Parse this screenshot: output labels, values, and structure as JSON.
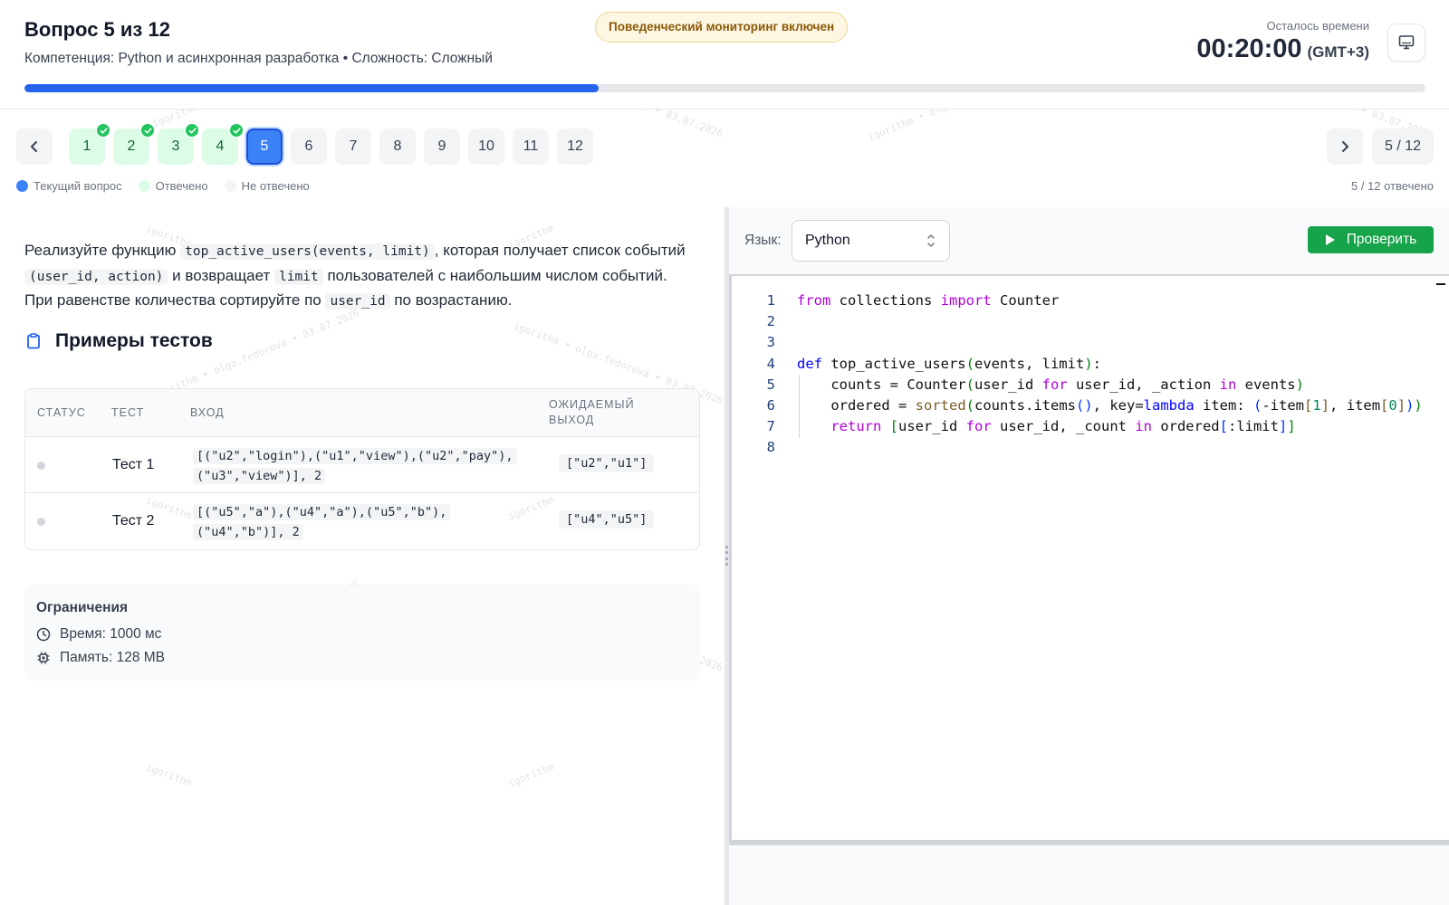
{
  "header": {
    "title": "Вопрос 5 из 12",
    "subtitle": "Компетенция: Python и асинхронная разработка • Сложность: Сложный",
    "monitoring_badge": "Поведенческий мониторинг включен",
    "time_label": "Осталось времени",
    "time_value": "00:20:00",
    "timezone": "(GMT+3)",
    "progress_fraction": 0.41
  },
  "nav": {
    "questions": [
      {
        "label": "1",
        "state": "answered"
      },
      {
        "label": "2",
        "state": "answered"
      },
      {
        "label": "3",
        "state": "answered"
      },
      {
        "label": "4",
        "state": "answered"
      },
      {
        "label": "5",
        "state": "current"
      },
      {
        "label": "6",
        "state": "unanswered"
      },
      {
        "label": "7",
        "state": "unanswered"
      },
      {
        "label": "8",
        "state": "unanswered"
      },
      {
        "label": "9",
        "state": "unanswered"
      },
      {
        "label": "10",
        "state": "unanswered"
      },
      {
        "label": "11",
        "state": "unanswered"
      },
      {
        "label": "12",
        "state": "unanswered"
      }
    ],
    "position": "5 / 12",
    "legend": {
      "current": "Текущий вопрос",
      "answered": "Отвечено",
      "unanswered": "Не отвечено"
    },
    "answered_status": "5 / 12 отвечено",
    "colors": {
      "current": "#3b82f6",
      "answered": "#dcfce7",
      "unanswered": "#f3f4f6"
    }
  },
  "task": {
    "d1": "Реализуйте функцию",
    "c1": "top_active_users(events, limit)",
    "d2": ", которая получает список событий",
    "c2": "(user_id, action)",
    "d3": "и возвращает",
    "c3": "limit",
    "d4": "пользователей с наибольшим числом событий. При равенстве количества сортируйте по",
    "c4": "user_id",
    "d5": "по возрастанию.",
    "tests_title": "Примеры тестов",
    "columns": {
      "status": "СТАТУС",
      "test": "ТЕСТ",
      "input": "ВХОД",
      "expected": "ОЖИДАЕМЫЙ ВЫХОД"
    },
    "tests": [
      {
        "name": "Тест 1",
        "input_l1": "[(\"u2\",\"login\"),(\"u1\",\"view\"),(\"u2\",\"pay\"),",
        "input_l2": "(\"u3\",\"view\")], 2",
        "expected": "[\"u2\",\"u1\"]"
      },
      {
        "name": "Тест 2",
        "input_l1": "[(\"u5\",\"a\"),(\"u4\",\"a\"),(\"u5\",\"b\"),",
        "input_l2": "(\"u4\",\"b\")], 2",
        "expected": "[\"u4\",\"u5\"]"
      }
    ],
    "limits_title": "Ограничения",
    "time_limit": "Время: 1000 мс",
    "memory_limit": "Память: 128 MB"
  },
  "editor": {
    "lang_label": "Язык:",
    "language": "Python",
    "run_label": "Проверить",
    "line_numbers": [
      "1",
      "2",
      "3",
      "4",
      "5",
      "6",
      "7",
      "8"
    ]
  },
  "watermark": {
    "brand": "igorithm",
    "long": "igorithm • olga.fedorova • 03.07.2026"
  }
}
